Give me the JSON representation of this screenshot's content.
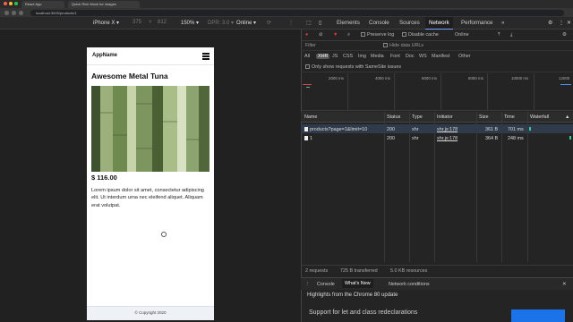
{
  "browser": {
    "tabs": [
      "React App",
      "Quick Rich Mock for images"
    ],
    "url": "localhost:3000/products/1"
  },
  "device_toolbar": {
    "device": "iPhone X ▾",
    "width": "375",
    "x": "×",
    "height": "812",
    "zoom": "150% ▾",
    "dpr": "DPR: 3.0 ▾",
    "throttle": "Online ▾"
  },
  "page": {
    "app_name": "AppName",
    "product_title": "Awesome Metal Tuna",
    "price": "$ 116.00",
    "description": "Lorem ipsum dolor sit amet, consectetur adipiscing elit. Ut interdum urna nec eleifend aliquet. Aliquam erat volutpat.",
    "footer": "© Copyright 2020"
  },
  "devtools": {
    "tabs": [
      "Elements",
      "Console",
      "Sources",
      "Network",
      "Performance"
    ],
    "active_tab": "Network",
    "toolbar": {
      "preserve_log": "Preserve log",
      "disable_cache": "Disable cache",
      "throttle": "Online"
    },
    "filter": {
      "placeholder": "Filter",
      "hide_data_urls": "Hide data URLs"
    },
    "types": [
      "All",
      "XHR",
      "JS",
      "CSS",
      "Img",
      "Media",
      "Font",
      "Doc",
      "WS",
      "Manifest",
      "Other"
    ],
    "selected_type": "XHR",
    "samesite": "Only show requests with SameSite issues",
    "timeline_labels": [
      "2000 ms",
      "4000 ms",
      "6000 ms",
      "8000 ms",
      "10000 ms",
      "12000"
    ],
    "columns": {
      "name": "Name",
      "status": "Status",
      "type": "Type",
      "initiator": "Initiator",
      "size": "Size",
      "time": "Time",
      "waterfall": "Waterfall"
    },
    "rows": [
      {
        "name": "products?page=1&limit=10",
        "status": "200",
        "type": "xhr",
        "initiator": "xhr.js:178",
        "size": "361 B",
        "time": "701 ms"
      },
      {
        "name": "1",
        "status": "200",
        "type": "xhr",
        "initiator": "xhr.js:178",
        "size": "364 B",
        "time": "248 ms"
      }
    ],
    "status": {
      "requests": "2 requests",
      "transferred": "725 B transferred",
      "resources": "5.0 KB resources"
    },
    "drawer": {
      "tabs": [
        "Console",
        "What's New",
        "Network conditions"
      ],
      "active": "What's New",
      "highlights": "Highlights from the Chrome 80 update",
      "support": "Support for let and class redeclarations"
    }
  }
}
